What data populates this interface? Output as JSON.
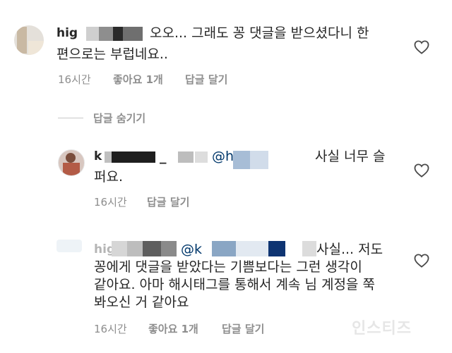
{
  "comments": [
    {
      "username_fragment": "hig",
      "line1": "오오... 그래도 꽁 댓글을 받으셨다니 한",
      "line2": "편으로는 부럽네요..",
      "time": "16시간",
      "likes": "좋아요 1개",
      "reply": "답글 달기"
    },
    {
      "username_fragment": "k",
      "mention": "@h",
      "line1": "사실 너무 슬",
      "line2": "퍼요.",
      "time": "16시간",
      "reply": "답글 달기"
    },
    {
      "username_fragment": "hig",
      "mention": "@k",
      "line1": "사실... 저도",
      "line2": "꽁에게 댓글을 받았다는 기쁨보다는 그런 생각이",
      "line3": "같아요. 아마 해시태그를 통해서 계속 님 계정을 쭉",
      "line4": "봐오신 거 같아요",
      "time": "16시간",
      "likes": "좋아요 1개",
      "reply": "답글 달기"
    }
  ],
  "hide_replies": "답글 숨기기",
  "watermark": "인스티즈",
  "colors": {
    "text": "#262626",
    "meta": "#8e8e8e",
    "mention": "#00376b"
  }
}
